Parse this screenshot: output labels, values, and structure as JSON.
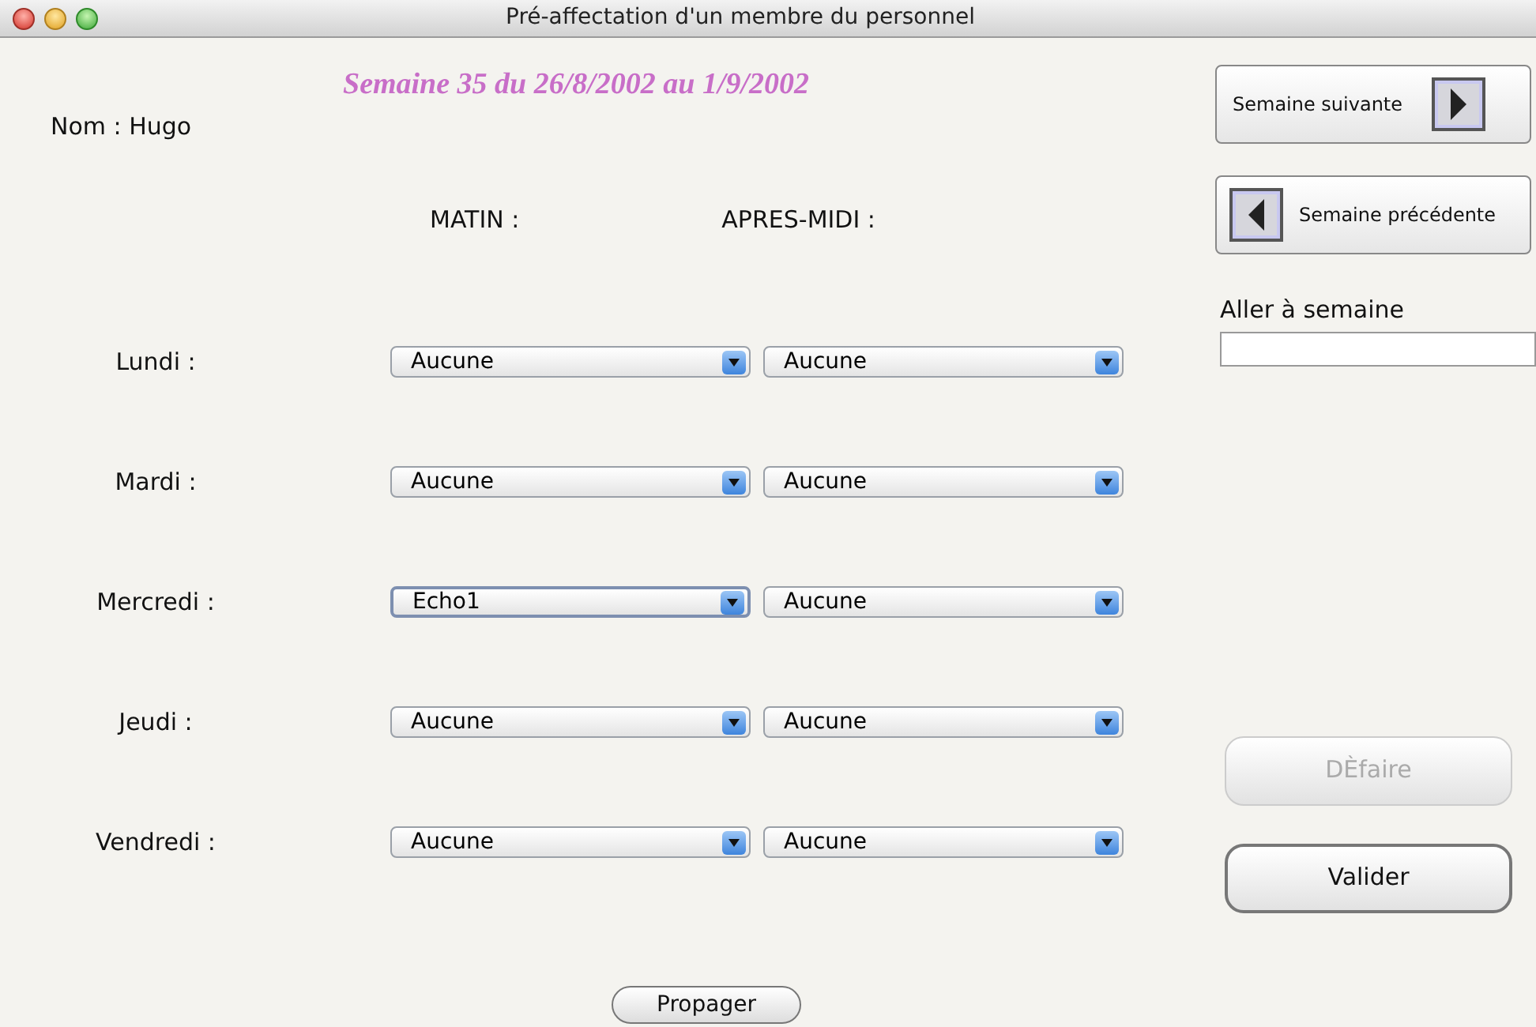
{
  "window": {
    "title": "Pré-affectation d'un membre du personnel"
  },
  "week_heading": "Semaine 35 du 26/8/2002 au 1/9/2002",
  "name_label": "Nom : Hugo",
  "columns": [
    "MATIN :",
    "APRES-MIDI :"
  ],
  "days": [
    {
      "label": "Lundi :",
      "morning": {
        "value": "Aucune",
        "focused": false
      },
      "afternoon": {
        "value": "Aucune",
        "focused": false
      }
    },
    {
      "label": "Mardi :",
      "morning": {
        "value": "Aucune",
        "focused": false
      },
      "afternoon": {
        "value": "Aucune",
        "focused": false
      }
    },
    {
      "label": "Mercredi :",
      "morning": {
        "value": "Echo1",
        "focused": true
      },
      "afternoon": {
        "value": "Aucune",
        "focused": false
      }
    },
    {
      "label": "Jeudi :",
      "morning": {
        "value": "Aucune",
        "focused": false
      },
      "afternoon": {
        "value": "Aucune",
        "focused": false
      }
    },
    {
      "label": "Vendredi :",
      "morning": {
        "value": "Aucune",
        "focused": false
      },
      "afternoon": {
        "value": "Aucune",
        "focused": false
      }
    }
  ],
  "propagate_button": "Propager",
  "next_week_button": "Semaine suivante",
  "previous_week_button": "Semaine précédente",
  "goto_week": {
    "label": "Aller à semaine"
  },
  "undo_button": {
    "label": "DÈfaire",
    "disabled": true
  },
  "validate_button": {
    "label": "Valider",
    "disabled": false
  }
}
